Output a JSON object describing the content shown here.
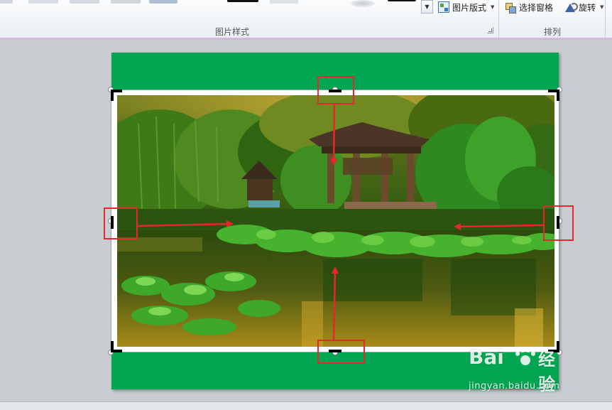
{
  "ribbon": {
    "picture_layout_label": "图片版式",
    "picture_styles_group_label": "图片样式",
    "selection_pane_label": "选择窗格",
    "rotate_label": "旋转",
    "arrange_group_label": "排列"
  },
  "icons": {
    "gallery_scroll": "gallery-more-icon",
    "picture_layout": "picture-layout-icon",
    "selection_pane": "selection-pane-icon",
    "rotate": "rotate-icon",
    "dialog_launcher": "dialog-launcher-icon"
  },
  "watermark": {
    "brand_left": "Bai",
    "brand_right": "经验",
    "url": "jingyan.baidu.com"
  },
  "colors": {
    "slide_background": "#00a651",
    "annotation_red": "#e8262b"
  }
}
